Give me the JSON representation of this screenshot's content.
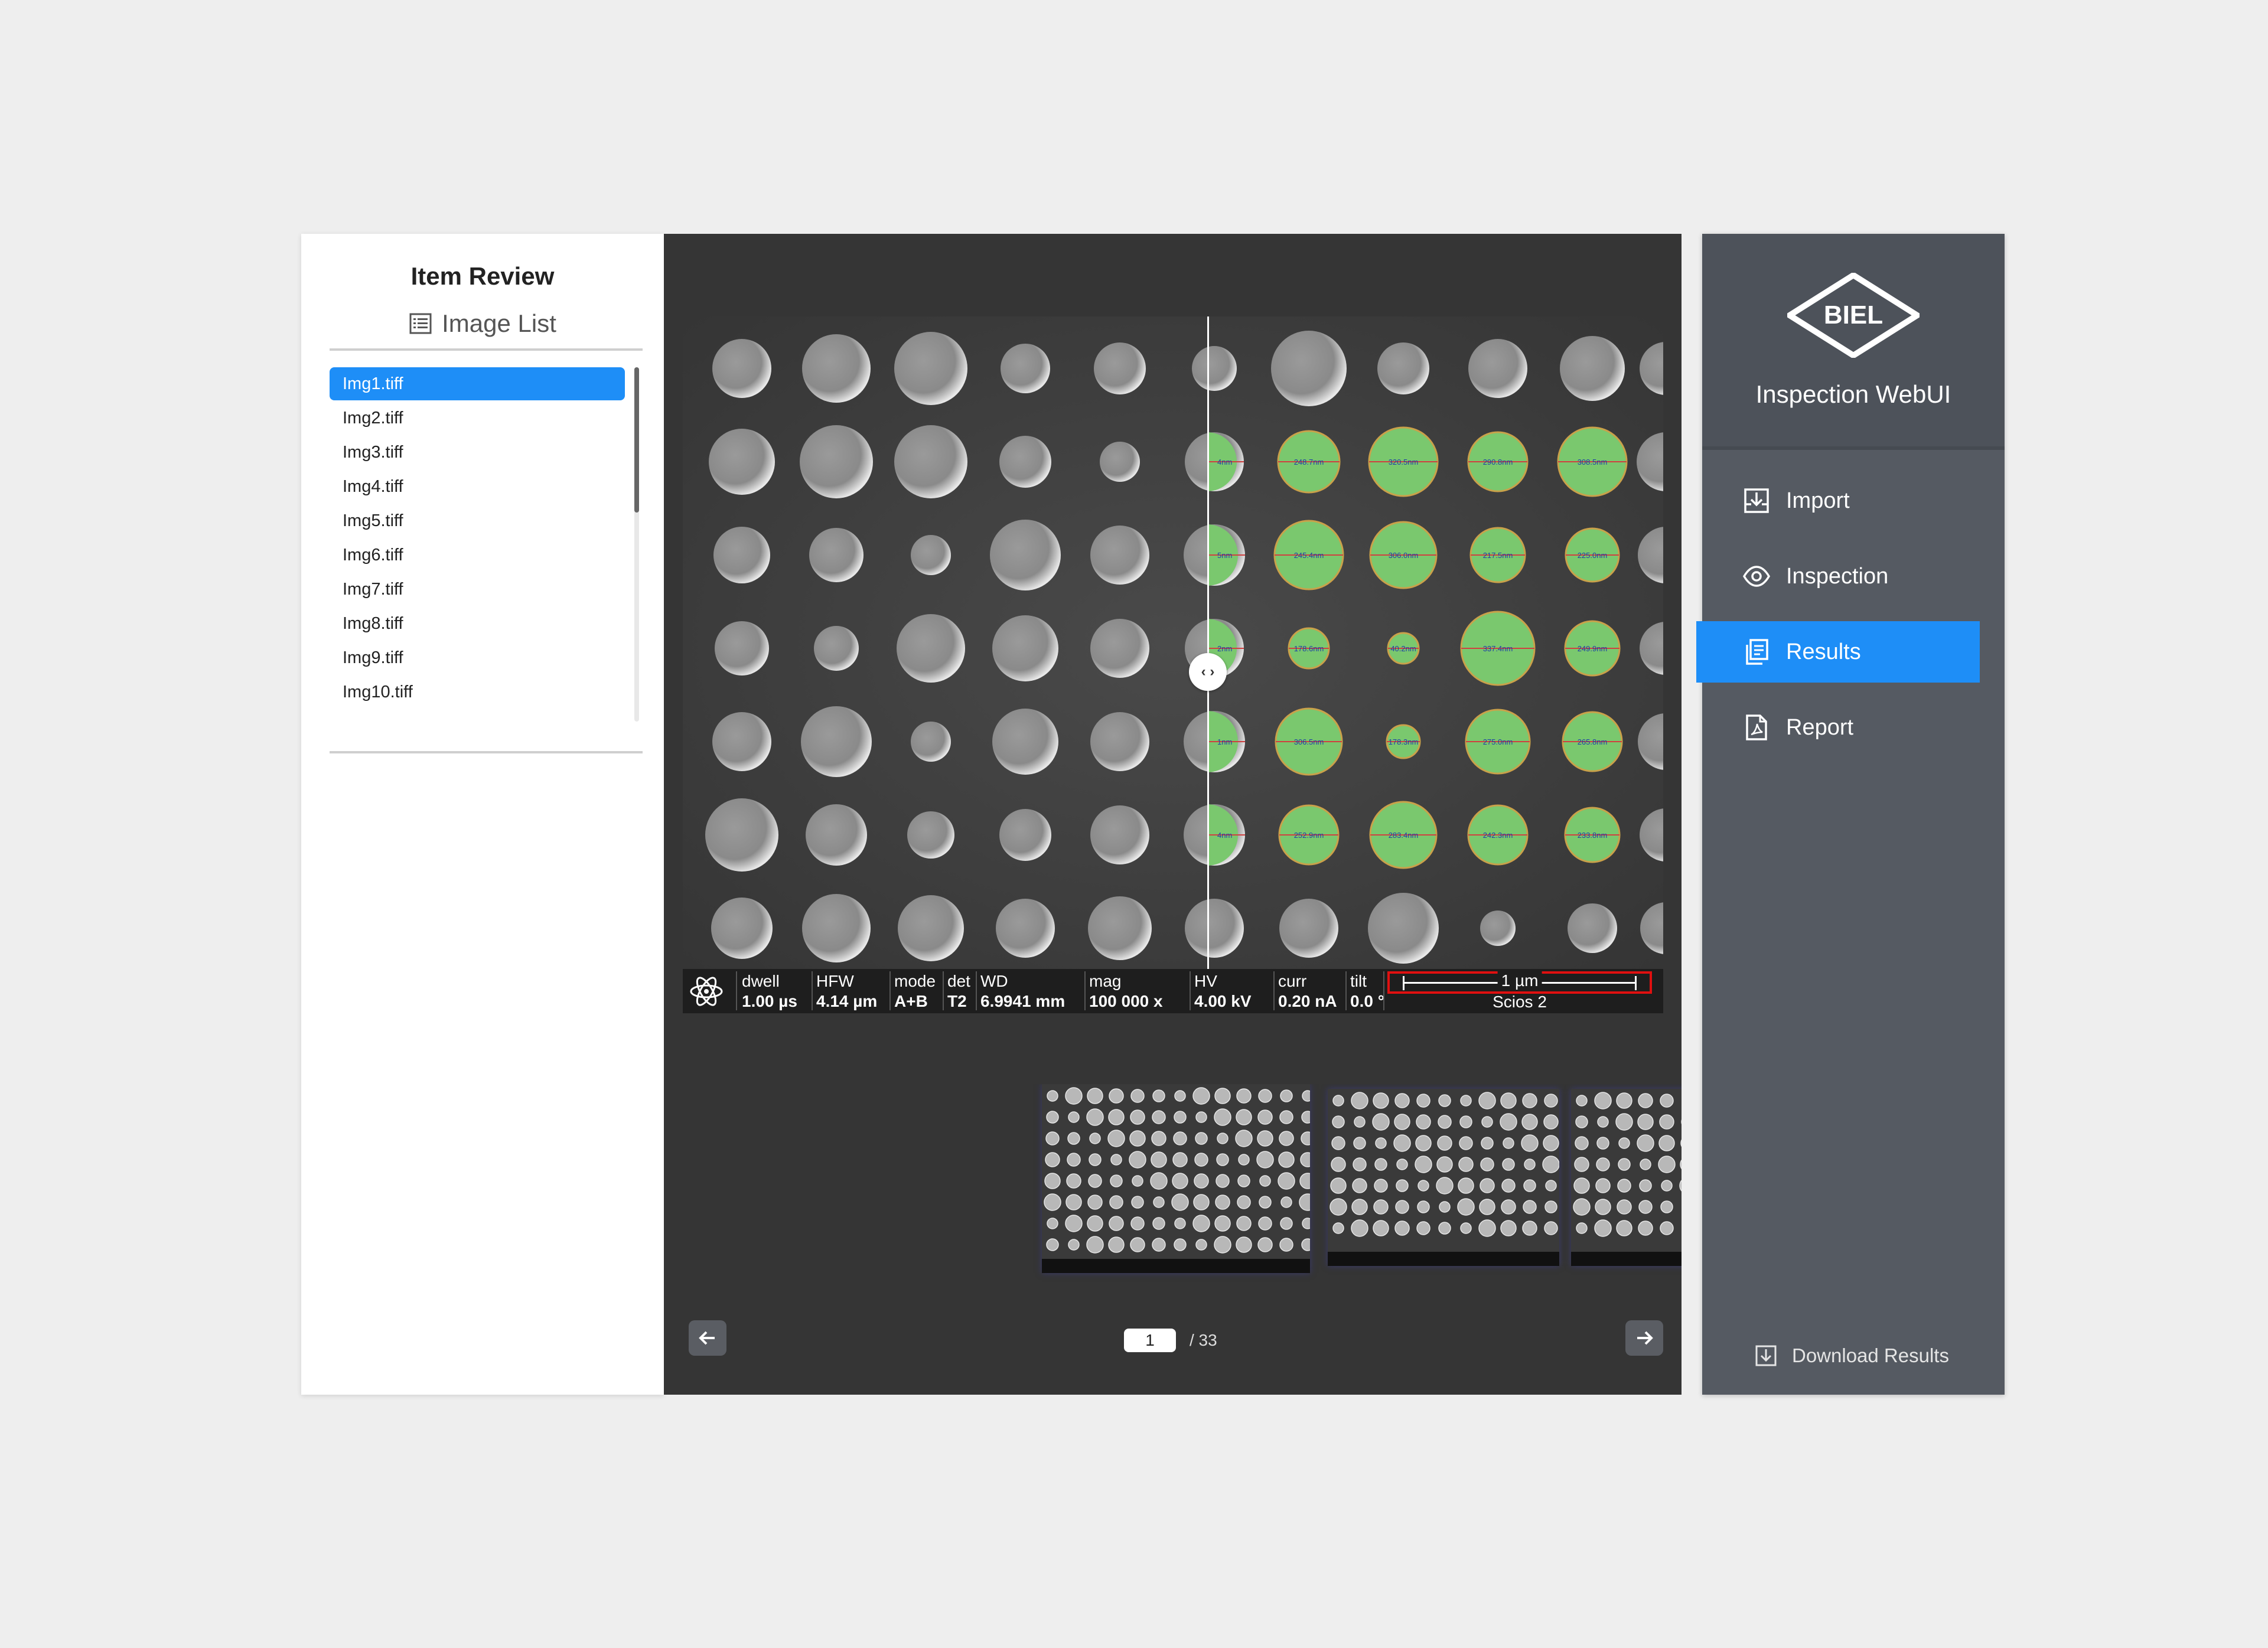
{
  "left_panel": {
    "title": "Item Review",
    "subtitle": "Image List",
    "images": [
      "Img1.tiff",
      "Img2.tiff",
      "Img3.tiff",
      "Img4.tiff",
      "Img5.tiff",
      "Img6.tiff",
      "Img7.tiff",
      "Img8.tiff",
      "Img9.tiff",
      "Img10.tiff"
    ],
    "selected_index": 0
  },
  "viewer": {
    "databar": {
      "dwell": {
        "label": "dwell",
        "value": "1.00 µs"
      },
      "hfw": {
        "label": "HFW",
        "value": "4.14 µm"
      },
      "mode": {
        "label": "mode",
        "value": "A+B"
      },
      "det": {
        "label": "det",
        "value": "T2"
      },
      "wd": {
        "label": "WD",
        "value": "6.9941 mm"
      },
      "mag": {
        "label": "mag",
        "value": "100 000 x"
      },
      "hv": {
        "label": "HV",
        "value": "4.00 kV"
      },
      "curr": {
        "label": "curr",
        "value": "0.20 nA"
      },
      "tilt": {
        "label": "tilt",
        "value": "0.0 °"
      },
      "scale": "1 µm",
      "instrument": "Scios 2"
    },
    "measurements": [
      [
        "248.7nm",
        "320.5nm",
        "290.8nm",
        "308.5nm"
      ],
      [
        "245.4nm",
        "306.0nm",
        "217.5nm",
        "225.0nm"
      ],
      [
        "178.6nm",
        "40.2nm",
        "337.4nm",
        "249.9nm"
      ],
      [
        "306.5nm",
        "178.3nm",
        "275.0nm",
        "265.8nm"
      ],
      [
        "252.9nm",
        "283.4nm",
        "242.3nm",
        "233.8nm"
      ]
    ],
    "edge_labels": [
      "4nm",
      "5nm",
      "2nm",
      "1nm",
      "4nm"
    ],
    "measure_color": "#7ac86e",
    "pager": {
      "current": "1",
      "total": "/  33"
    }
  },
  "sidebar": {
    "brand": "BIEL",
    "app_title": "Inspection WebUI",
    "menu": [
      {
        "label": "Import",
        "icon": "import-icon"
      },
      {
        "label": "Inspection",
        "icon": "eye-icon"
      },
      {
        "label": "Results",
        "icon": "results-icon"
      },
      {
        "label": "Report",
        "icon": "report-icon"
      }
    ],
    "active_menu": "Results",
    "download_label": "Download Results"
  },
  "colors": {
    "accent": "#1e8ef7",
    "sidebar": "#555a62",
    "viewer": "#353535"
  }
}
